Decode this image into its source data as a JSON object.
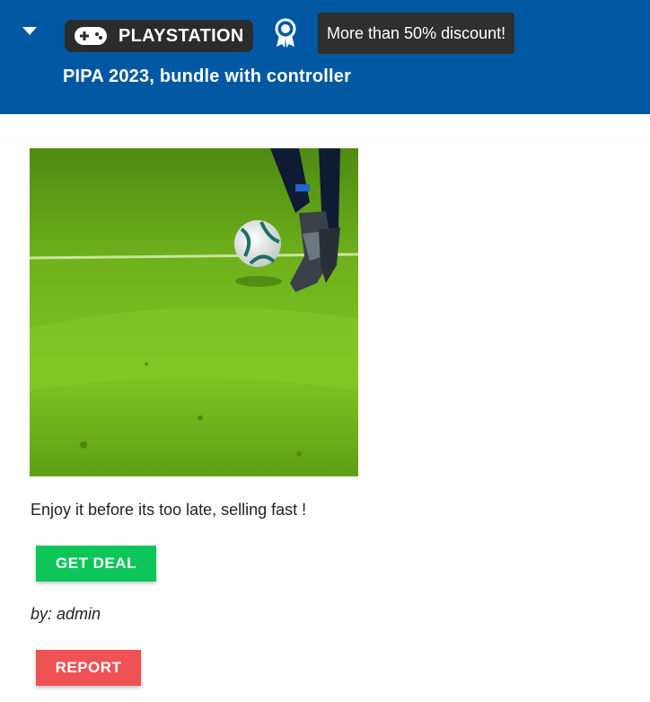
{
  "header": {
    "platform_label": "PLAYSTATION",
    "platform_icon": "gamepad-icon",
    "award_icon": "award-ribbon-icon",
    "collapse_icon": "caret-down-icon",
    "tooltip_text": "More than 50% discount!",
    "title": "PIPA 2023, bundle with controller",
    "background_color": "#0058a3"
  },
  "deal": {
    "image_subject": "soccer ball on grass field with player's boot",
    "description": "Enjoy it before its too late, selling fast !",
    "get_deal_label": "GET DEAL",
    "author": "by: admin",
    "report_label": "REPORT"
  },
  "colors": {
    "get_deal": "#0cc65a",
    "report": "#ee5253",
    "chip": "#2b2b2b",
    "tooltip": "#2f2f2f"
  }
}
